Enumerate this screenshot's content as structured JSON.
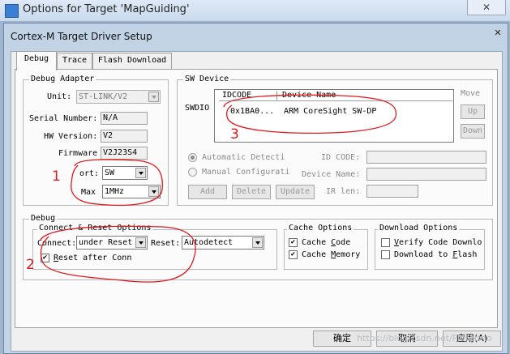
{
  "outer_window": {
    "title": "Options for Target 'MapGuiding'",
    "close_glyph": "✕"
  },
  "dialog": {
    "title": "Cortex-M Target Driver Setup",
    "close_glyph": "✕"
  },
  "tabs": [
    {
      "label": "Debug",
      "active": true
    },
    {
      "label": "Trace",
      "active": false
    },
    {
      "label": "Flash Download",
      "active": false
    }
  ],
  "debug_adapter": {
    "title": "Debug Adapter",
    "unit_label": "Unit:",
    "unit_value": "ST-LINK/V2",
    "serial_label": "Serial Number:",
    "serial_value": "N/A",
    "hw_label": "HW Version:",
    "hw_value": "V2",
    "fw_label": "Firmware",
    "fw_value": "V2J23S4",
    "port_label": "ort:",
    "port_value": "SW",
    "max_label": "Max",
    "max_value": "1MHz"
  },
  "sw_device": {
    "title": "SW Device",
    "swdio_label": "SWDIO",
    "col_idcode": "IDCODE",
    "col_device": "Device Name",
    "row_idcode": "0x1BA0...",
    "row_device": "ARM CoreSight SW-DP",
    "move_label": "Move",
    "up_label": "Up",
    "down_label": "Down",
    "auto_detect": "Automatic Detecti",
    "manual_config": "Manual Configurati",
    "id_code_label": "ID CODE:",
    "device_name_label": "Device Name:",
    "ir_len_label": "IR len:",
    "add_label": "Add",
    "delete_label": "Delete",
    "update_label": "Update"
  },
  "debug": {
    "title": "Debug",
    "connect_reset": {
      "title": "Connect & Reset Options",
      "connect_label": "Connect:",
      "connect_value": "under Reset",
      "reset_label": "Reset:",
      "reset_value": "Autodetect",
      "reset_after_conn": "Reset after Conn",
      "reset_after_conn_checked": true
    },
    "cache_options": {
      "title": "Cache Options",
      "cache_code": "Cache Code",
      "cache_code_checked": true,
      "cache_memory": "Cache Memory",
      "cache_memory_checked": true
    },
    "download_options": {
      "title": "Download Options",
      "verify": "Verify Code Downlo",
      "verify_checked": false,
      "download_flash": "Download to Flash",
      "download_flash_checked": false
    }
  },
  "buttons": {
    "ok": "确定",
    "cancel": "取消",
    "apply": "应用(A)"
  },
  "annotations": {
    "one": "1",
    "two": "2",
    "three": "3",
    "color": "#e0191e"
  },
  "watermark": "https://blog.csdn.net/Pietermo"
}
